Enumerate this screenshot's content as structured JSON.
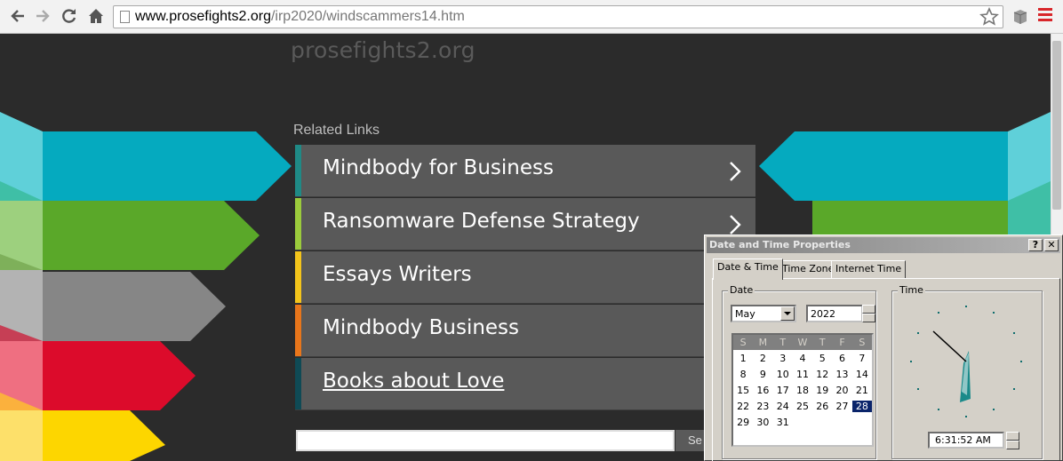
{
  "browser": {
    "url_host": "www.prosefights2.org",
    "url_path": "/irp2020/windscammers14.htm"
  },
  "site": {
    "title": "prosefights2.org",
    "related_links_heading": "Related Links",
    "links": [
      {
        "label": "Mindbody for Business",
        "accent": "#1f8a86"
      },
      {
        "label": "Ransomware Defense Strategy",
        "accent": "#9bcb3c"
      },
      {
        "label": "Essays Writers",
        "accent": "#f3c41b"
      },
      {
        "label": "Mindbody Business",
        "accent": "#e8761b"
      },
      {
        "label": "Books about Love",
        "accent": "#0f4a55"
      }
    ],
    "search_button": "Se"
  },
  "dialog": {
    "title": "Date and Time Properties",
    "help_button": "?",
    "close_button": "✕",
    "tabs": [
      "Date & Time",
      "Time Zone",
      "Internet Time"
    ],
    "date_group": "Date",
    "time_group": "Time",
    "month": "May",
    "year": "2022",
    "weekdays": [
      "S",
      "M",
      "T",
      "W",
      "T",
      "F",
      "S"
    ],
    "weeks": [
      [
        "1",
        "2",
        "3",
        "4",
        "5",
        "6",
        "7"
      ],
      [
        "8",
        "9",
        "10",
        "11",
        "12",
        "13",
        "14"
      ],
      [
        "15",
        "16",
        "17",
        "18",
        "19",
        "20",
        "21"
      ],
      [
        "22",
        "23",
        "24",
        "25",
        "26",
        "27",
        "28"
      ],
      [
        "29",
        "30",
        "31",
        "",
        "",
        "",
        ""
      ]
    ],
    "selected_day": "28",
    "time": "6:31:52 AM"
  }
}
